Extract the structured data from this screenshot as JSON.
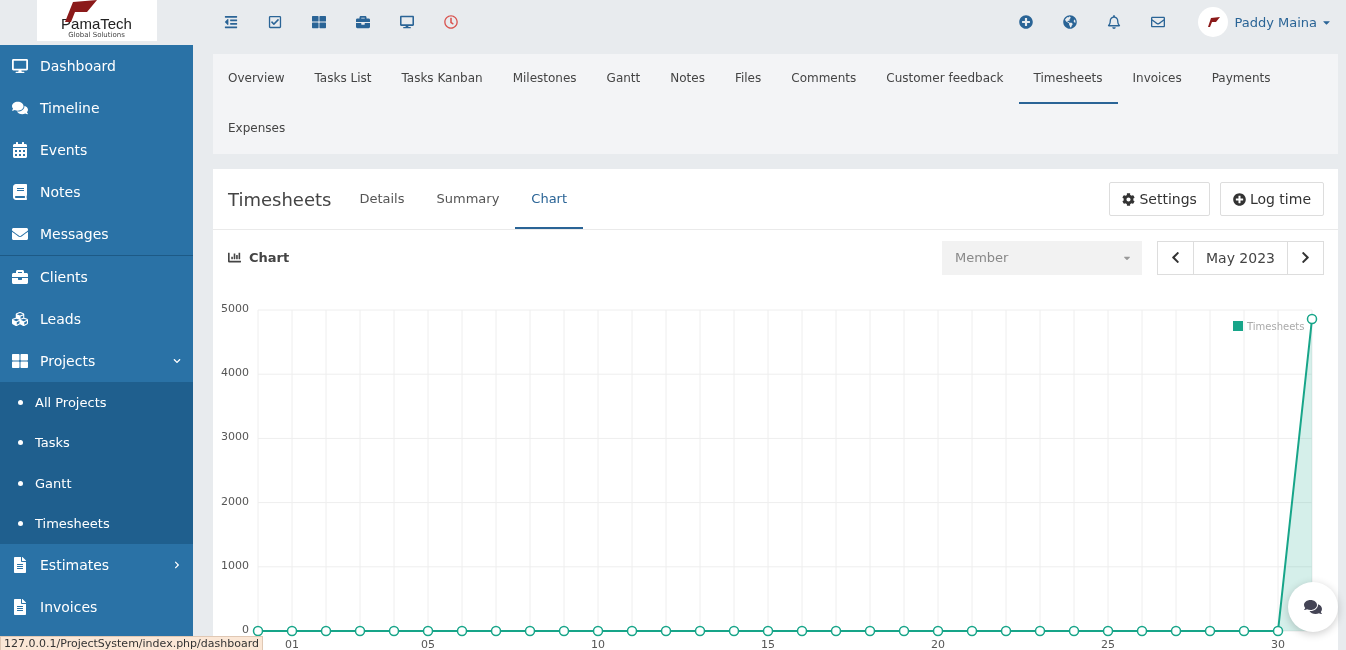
{
  "logo": {
    "name": "PamaTech",
    "tagline": "Global Solutions"
  },
  "topbar": {
    "user": "Paddy Maina"
  },
  "sidebar": {
    "items": [
      {
        "kind": "link",
        "label": "Dashboard"
      },
      {
        "kind": "link",
        "label": "Timeline"
      },
      {
        "kind": "link",
        "label": "Events"
      },
      {
        "kind": "link",
        "label": "Notes"
      },
      {
        "kind": "link",
        "label": "Messages"
      },
      {
        "kind": "link",
        "label": "Clients"
      },
      {
        "kind": "link",
        "label": "Leads"
      },
      {
        "kind": "group",
        "label": "Projects",
        "expanded": true,
        "children": [
          {
            "label": "All Projects"
          },
          {
            "label": "Tasks"
          },
          {
            "label": "Gantt"
          },
          {
            "label": "Timesheets"
          }
        ]
      },
      {
        "kind": "group",
        "label": "Estimates",
        "expanded": false
      },
      {
        "kind": "link",
        "label": "Invoices"
      }
    ]
  },
  "project_tabs": [
    {
      "label": "Overview",
      "selected": false
    },
    {
      "label": "Tasks List",
      "selected": false
    },
    {
      "label": "Tasks Kanban",
      "selected": false
    },
    {
      "label": "Milestones",
      "selected": false
    },
    {
      "label": "Gantt",
      "selected": false
    },
    {
      "label": "Notes",
      "selected": false
    },
    {
      "label": "Files",
      "selected": false
    },
    {
      "label": "Comments",
      "selected": false
    },
    {
      "label": "Customer feedback",
      "selected": false
    },
    {
      "label": "Timesheets",
      "selected": true
    },
    {
      "label": "Invoices",
      "selected": false
    },
    {
      "label": "Payments",
      "selected": false
    },
    {
      "label": "Expenses",
      "selected": false
    }
  ],
  "timesheets": {
    "title": "Timesheets",
    "tabs": [
      {
        "label": "Details",
        "selected": false
      },
      {
        "label": "Summary",
        "selected": false
      },
      {
        "label": "Chart",
        "selected": true
      }
    ],
    "buttons": [
      "Settings",
      "Log time"
    ]
  },
  "chart_panel": {
    "title": "Chart",
    "member_select": {
      "placeholder": "Member"
    },
    "period": "May 2023",
    "chart_data": {
      "type": "area",
      "x": [
        0,
        1,
        2,
        3,
        4,
        5,
        6,
        7,
        8,
        9,
        10,
        11,
        12,
        13,
        14,
        15,
        16,
        17,
        18,
        19,
        20,
        21,
        22,
        23,
        24,
        25,
        26,
        27,
        28,
        29,
        30,
        31
      ],
      "series": [
        {
          "name": "Timesheets",
          "color": "#17a589",
          "values": [
            0,
            0,
            0,
            0,
            0,
            0,
            0,
            0,
            0,
            0,
            0,
            0,
            0,
            0,
            0,
            0,
            0,
            0,
            0,
            0,
            0,
            0,
            0,
            0,
            0,
            0,
            0,
            0,
            0,
            0,
            0,
            4860
          ]
        }
      ],
      "xlim": [
        0,
        31
      ],
      "grid": true,
      "ylim": [
        0,
        5000
      ],
      "yticks": [
        0,
        1000,
        2000,
        3000,
        4000,
        5000
      ],
      "xticks": [
        {
          "value": 1,
          "label": "01"
        },
        {
          "value": 5,
          "label": "05"
        },
        {
          "value": 10,
          "label": "10"
        },
        {
          "value": 15,
          "label": "15"
        },
        {
          "value": 20,
          "label": "20"
        },
        {
          "value": 25,
          "label": "25"
        },
        {
          "value": 30,
          "label": "30"
        }
      ]
    }
  },
  "status_bar": "127.0.0.1/ProjectSystem/index.php/dashboard"
}
